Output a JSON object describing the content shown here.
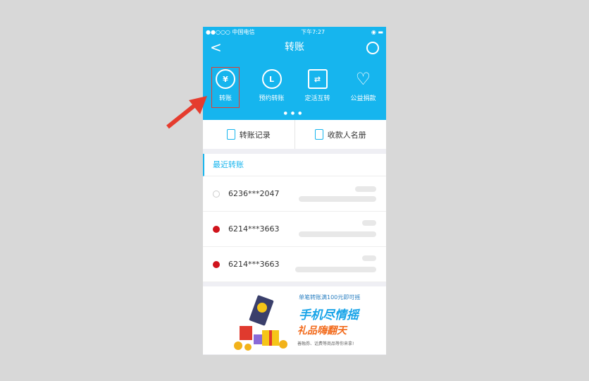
{
  "status": {
    "carrier": "●●○○○ 中国电信",
    "time": "下午7:27"
  },
  "nav": {
    "title": "转账",
    "back": "<"
  },
  "grid": [
    {
      "label": "转账",
      "icon": "¥"
    },
    {
      "label": "预约转账",
      "icon": "L"
    },
    {
      "label": "定活互转",
      "icon": "⇄"
    },
    {
      "label": "公益捐款",
      "icon": "♡"
    }
  ],
  "dots": "●●●",
  "buttons": {
    "records": "转账记录",
    "payees": "收款人名册"
  },
  "recent": {
    "title": "最近转账",
    "items": [
      {
        "account": "6236***2047",
        "bank_color": "#cccccc"
      },
      {
        "account": "6214***3663",
        "bank_color": "#d0141c"
      },
      {
        "account": "6214***3663",
        "bank_color": "#d0141c"
      }
    ]
  },
  "banner": {
    "line1": "单笔转账满100元即可摇",
    "line2": "手机尽情摇",
    "line3": "礼品嗨翻天",
    "line4": "善融券、话费等商品等你来拿!"
  },
  "colors": {
    "primary": "#16b5ee",
    "highlight": "#e53c2e"
  }
}
